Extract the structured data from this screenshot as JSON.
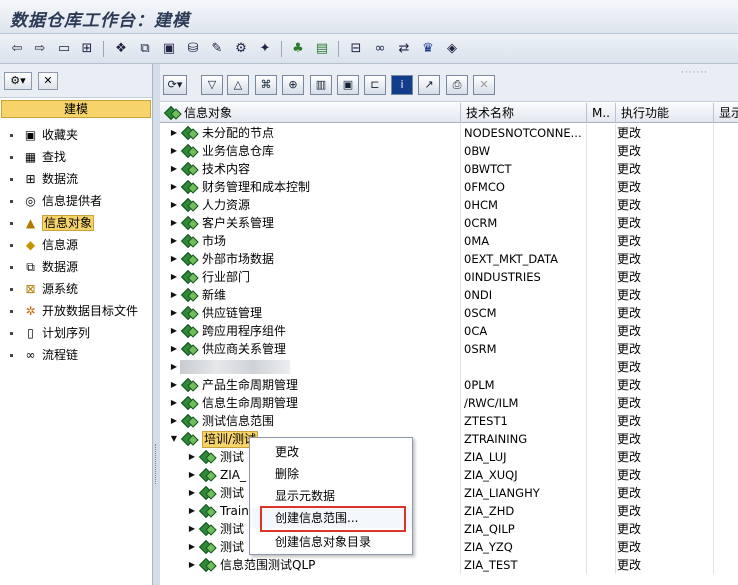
{
  "window": {
    "title": "数据仓库工作台：建模"
  },
  "toolbar": {
    "icons": [
      "arrow-left-icon",
      "arrow-right-icon",
      "window-icon",
      "tree-icon",
      "modeling-icon",
      "connect-icon",
      "cube-icon",
      "database-icon",
      "workbench-icon",
      "transport-icon",
      "wand-icon",
      "tree-plus-icon",
      "document-icon",
      "hierarchy-icon",
      "link-icon",
      "switch-icon",
      "trophy-icon",
      "eraser-icon"
    ]
  },
  "left": {
    "header": "建模",
    "items": [
      {
        "label": "收藏夹",
        "icon": "favorites-icon"
      },
      {
        "label": "查找",
        "icon": "find-icon"
      },
      {
        "label": "数据流",
        "icon": "dataflow-icon"
      },
      {
        "label": "信息提供者",
        "icon": "infoprovider-icon"
      },
      {
        "label": "信息对象",
        "icon": "infoobject-icon"
      },
      {
        "label": "信息源",
        "icon": "infosource-icon"
      },
      {
        "label": "数据源",
        "icon": "datasource-icon"
      },
      {
        "label": "源系统",
        "icon": "sourcesystem-icon"
      },
      {
        "label": "开放数据目标文件",
        "icon": "opendest-icon"
      },
      {
        "label": "计划序列",
        "icon": "schedule-icon"
      },
      {
        "label": "流程链",
        "icon": "processchain-icon"
      }
    ]
  },
  "grid": {
    "columns": [
      "信息对象",
      "技术名称",
      "M..",
      "执行功能",
      "显示"
    ],
    "rows": [
      {
        "name": "未分配的节点",
        "tech": "NODESNOTCONNE...",
        "func": "更改",
        "level": 0,
        "exp": "collapsed"
      },
      {
        "name": "业务信息仓库",
        "tech": "0BW",
        "func": "更改",
        "level": 0,
        "exp": "collapsed"
      },
      {
        "name": "技术内容",
        "tech": "0BWTCT",
        "func": "更改",
        "level": 0,
        "exp": "collapsed"
      },
      {
        "name": "财务管理和成本控制",
        "tech": "0FMCO",
        "func": "更改",
        "level": 0,
        "exp": "collapsed"
      },
      {
        "name": "人力资源",
        "tech": "0HCM",
        "func": "更改",
        "level": 0,
        "exp": "collapsed"
      },
      {
        "name": "客户关系管理",
        "tech": "0CRM",
        "func": "更改",
        "level": 0,
        "exp": "collapsed"
      },
      {
        "name": "市场",
        "tech": "0MA",
        "func": "更改",
        "level": 0,
        "exp": "collapsed"
      },
      {
        "name": "外部市场数据",
        "tech": "0EXT_MKT_DATA",
        "func": "更改",
        "level": 0,
        "exp": "collapsed"
      },
      {
        "name": "行业部门",
        "tech": "0INDUSTRIES",
        "func": "更改",
        "level": 0,
        "exp": "collapsed"
      },
      {
        "name": "新维",
        "tech": "0NDI",
        "func": "更改",
        "level": 0,
        "exp": "collapsed"
      },
      {
        "name": "供应链管理",
        "tech": "0SCM",
        "func": "更改",
        "level": 0,
        "exp": "collapsed"
      },
      {
        "name": "跨应用程序组件",
        "tech": "0CA",
        "func": "更改",
        "level": 0,
        "exp": "collapsed"
      },
      {
        "name": "供应商关系管理",
        "tech": "0SRM",
        "func": "更改",
        "level": 0,
        "exp": "collapsed"
      },
      {
        "name": "",
        "tech": "",
        "func": "更改",
        "level": 0,
        "exp": "collapsed",
        "blurred": true
      },
      {
        "name": "产品生命周期管理",
        "tech": "0PLM",
        "func": "更改",
        "level": 0,
        "exp": "collapsed"
      },
      {
        "name": "信息生命周期管理",
        "tech": "/RWC/ILM",
        "func": "更改",
        "level": 0,
        "exp": "collapsed"
      },
      {
        "name": "测试信息范围",
        "tech": "ZTEST1",
        "func": "更改",
        "level": 0,
        "exp": "collapsed"
      },
      {
        "name": "培训/测试",
        "tech": "ZTRAINING",
        "func": "更改",
        "level": 0,
        "exp": "expanded",
        "selected": true
      },
      {
        "name": "测试",
        "tech": "ZIA_LUJ",
        "func": "更改",
        "level": 1,
        "exp": "collapsed"
      },
      {
        "name": "ZIA_",
        "tech": "ZIA_XUQJ",
        "func": "更改",
        "level": 1,
        "exp": "collapsed"
      },
      {
        "name": "测试",
        "tech": "ZIA_LIANGHY",
        "func": "更改",
        "level": 1,
        "exp": "collapsed"
      },
      {
        "name": "Train",
        "tech": "ZIA_ZHD",
        "func": "更改",
        "level": 1,
        "exp": "collapsed"
      },
      {
        "name": "测试",
        "tech": "ZIA_QILP",
        "func": "更改",
        "level": 1,
        "exp": "collapsed"
      },
      {
        "name": "测试",
        "tech": "ZIA_YZQ",
        "func": "更改",
        "level": 1,
        "exp": "collapsed"
      },
      {
        "name": "信息范围测试QLP",
        "tech": "ZIA_TEST",
        "func": "更改",
        "level": 1,
        "exp": "collapsed"
      }
    ]
  },
  "context_menu": {
    "items": [
      "更改",
      "删除",
      "显示元数据",
      "创建信息范围...",
      "创建信息对象目录"
    ],
    "highlighted_index": 3
  }
}
